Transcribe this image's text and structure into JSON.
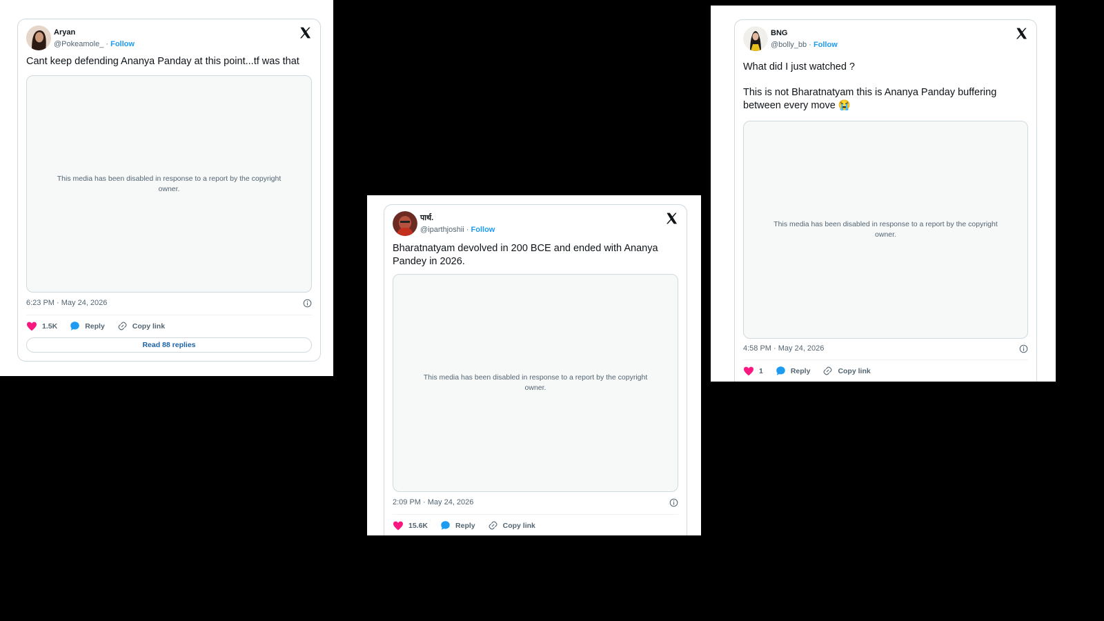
{
  "tweets": [
    {
      "name": "Aryan",
      "handle": "@Pokeamole_",
      "follow": "Follow",
      "text_lines": [
        "Cant keep defending Ananya Panday at this point...tf was that"
      ],
      "media_notice": "This media has been disabled in response to a report by the copyright owner.",
      "timestamp": "6:23 PM · May 24, 2026",
      "likes": "1.5K",
      "reply_label": "Reply",
      "copy_label": "Copy link",
      "read_replies": "Read 88 replies"
    },
    {
      "name": "पार्थ.",
      "handle": "@iparthjoshii",
      "follow": "Follow",
      "text_lines": [
        "Bharatnatyam devolved in 200 BCE and ended with Ananya Pandey in 2026."
      ],
      "media_notice": "This media has been disabled in response to a report by the copyright owner.",
      "timestamp": "2:09 PM · May 24, 2026",
      "likes": "15.6K",
      "reply_label": "Reply",
      "copy_label": "Copy link"
    },
    {
      "name": "BNG",
      "handle": "@bolly_bb",
      "follow": "Follow",
      "text_lines": [
        "What did I just watched ?",
        "This is not Bharatnatyam this is Ananya Panday buffering between every move 😭"
      ],
      "media_notice": "This media has been disabled in response to a report by the copyright owner.",
      "timestamp": "4:58 PM · May 24, 2026",
      "likes": "1",
      "reply_label": "Reply",
      "copy_label": "Copy link"
    }
  ],
  "colors": {
    "background": "#000000",
    "heart": "#f91880",
    "reply_bubble": "#1d9bf0",
    "follow_link": "#1d9bf0"
  },
  "icons": [
    "x-logo-icon",
    "info-icon",
    "heart-icon",
    "reply-bubble-icon",
    "link-icon"
  ]
}
